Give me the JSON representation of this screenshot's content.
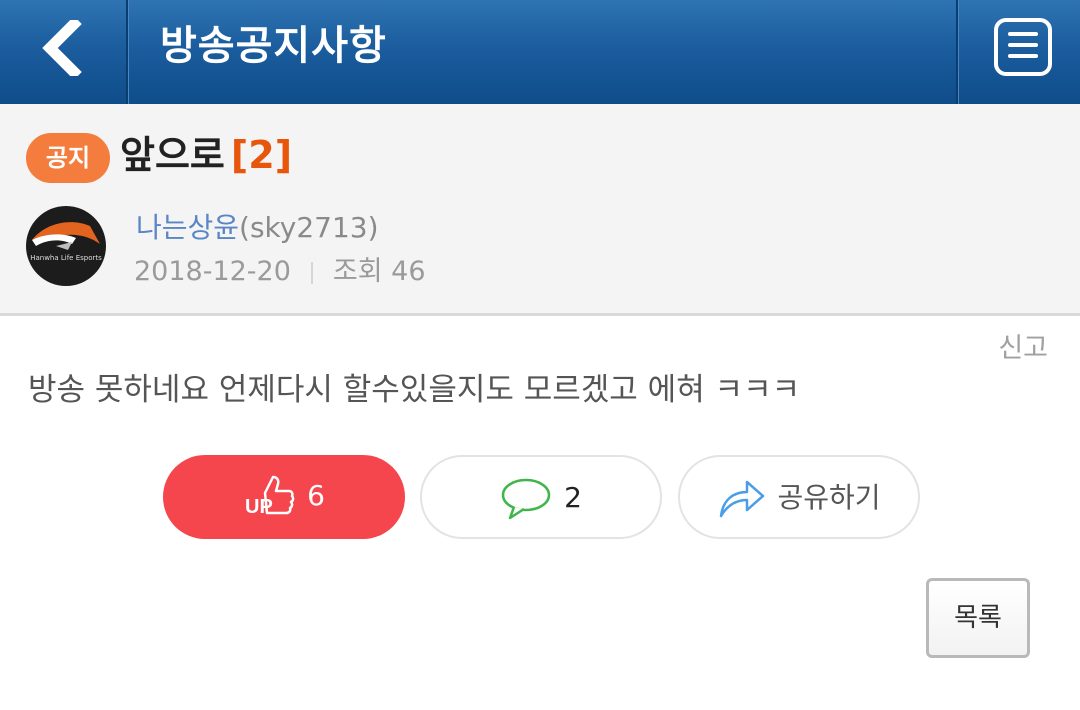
{
  "header": {
    "title": "방송공지사항",
    "back_icon": "chevron-left-icon",
    "menu_icon": "hamburger-menu-icon"
  },
  "post": {
    "badge": "공지",
    "title": "앞으로",
    "comment_count_label": "[2]",
    "author_nick": "나는상윤",
    "author_id": "(sky2713)",
    "date": "2018-12-20",
    "views": "조회 46",
    "report": "신고",
    "body": "방송 못하네요 언제다시 할수있을지도 모르겠고 에혀 ㅋㅋㅋ"
  },
  "avatar": {
    "logo_text": "Hanwha Life Esports"
  },
  "actions": {
    "like_count": "6",
    "comment_count": "2",
    "share_label": "공유하기",
    "list_label": "목록"
  },
  "colors": {
    "header": "#1b5d9e",
    "badge": "#f47c3c",
    "like": "#f4464c",
    "accent_count": "#e8560c",
    "author": "#5a86c5"
  }
}
